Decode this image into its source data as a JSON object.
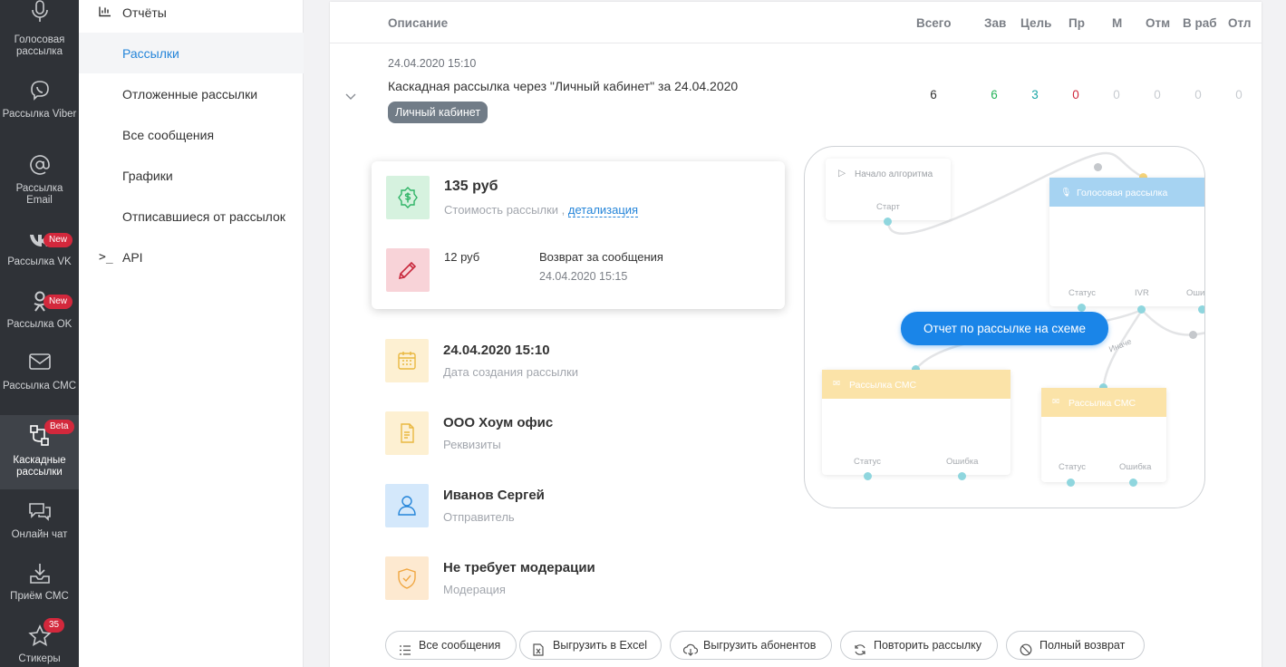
{
  "rail": [
    {
      "label": "Голосовая рассылка",
      "icon": "microphone-icon",
      "badge": ""
    },
    {
      "label": "Рассылка Viber",
      "icon": "viber-icon",
      "badge": ""
    },
    {
      "label": "Рассылка Email",
      "icon": "at-sign-icon",
      "badge": ""
    },
    {
      "label": "Рассылка VK",
      "icon": "vk-icon",
      "badge": "New"
    },
    {
      "label": "Рассылка OK",
      "icon": "odnoklassniki-icon",
      "badge": "New"
    },
    {
      "label": "Рассылка СМС",
      "icon": "envelope-icon",
      "badge": ""
    },
    {
      "label": "Каскадные рассылки",
      "icon": "cascade-icon",
      "badge": "Beta",
      "active": true
    },
    {
      "label": "Онлайн чат",
      "icon": "chat-icon",
      "badge": ""
    },
    {
      "label": "Приём СМС",
      "icon": "inbox-icon",
      "badge": ""
    },
    {
      "label": "Стикеры",
      "icon": "star-icon",
      "badge": "35"
    }
  ],
  "menu": {
    "reports": "Отчёты",
    "mailings": "Рассылки",
    "deferred": "Отложенные рассылки",
    "all_messages": "Все сообщения",
    "schedules": "Графики",
    "unsubscribed": "Отписавшиеся от рассылок",
    "api": "API",
    "api_icon": ">_"
  },
  "table": {
    "headers": {
      "description": "Описание",
      "total": "Всего",
      "delivered": "Зав",
      "target": "Цель",
      "pr": "Пр",
      "m": "М",
      "rejected": "Отм",
      "in_work": "В раб",
      "otl": "Отл"
    },
    "row": {
      "datetime": "24.04.2020 15:10",
      "title": "Каскадная рассылка через \"Личный кабинет\" за 24.04.2020",
      "tag": "Личный кабинет",
      "values": [
        "6",
        "6",
        "3",
        "0",
        "0",
        "0",
        "0",
        "0"
      ]
    }
  },
  "colors": {
    "green": "#26b35a",
    "teal": "#1aa6a6",
    "red": "#d0283c",
    "muted": "#c8ccd1",
    "accent": "#2585d9"
  },
  "price": {
    "amount": "135 руб",
    "caption": "Стоимость рассылки ,",
    "link": "детализация",
    "refund_amount": "12 руб",
    "refund_title": "Возврат за сообщения",
    "refund_date": "24.04.2020 15:15"
  },
  "details": [
    {
      "title": "24.04.2020 15:10",
      "sub": "Дата создания рассылки",
      "icon": "calendar-icon"
    },
    {
      "title": "ООО Хоум офис",
      "sub": "Реквизиты",
      "icon": "document-icon"
    },
    {
      "title": "Иванов Сергей",
      "sub": "Отправитель",
      "icon": "user-icon"
    },
    {
      "title": "Не требует модерации",
      "sub": "Модерация",
      "icon": "shield-check-icon"
    }
  ],
  "scheme": {
    "start_node": "Начало алгоритма",
    "start_label": "Старт",
    "voice_node": "Голосовая рассылка",
    "voice_status": "Статус",
    "voice_ivr": "IVR",
    "voice_err": "Ошибка",
    "sms1_node": "Рассылка СМС",
    "sms1_status": "Статус",
    "sms1_err": "Ошибка",
    "sms2_node": "Рассылка СМС",
    "sms2_status": "Статус",
    "sms2_err": "Ошибка",
    "else_label": "Иначе",
    "button": "Отчет по рассылке на схеме"
  },
  "buttons": {
    "all_messages": "Все сообщения",
    "export_excel": "Выгрузить в Excel",
    "export_subscribers": "Выгрузить абонентов",
    "repeat": "Повторить рассылку",
    "full_refund": "Полный возврат"
  }
}
